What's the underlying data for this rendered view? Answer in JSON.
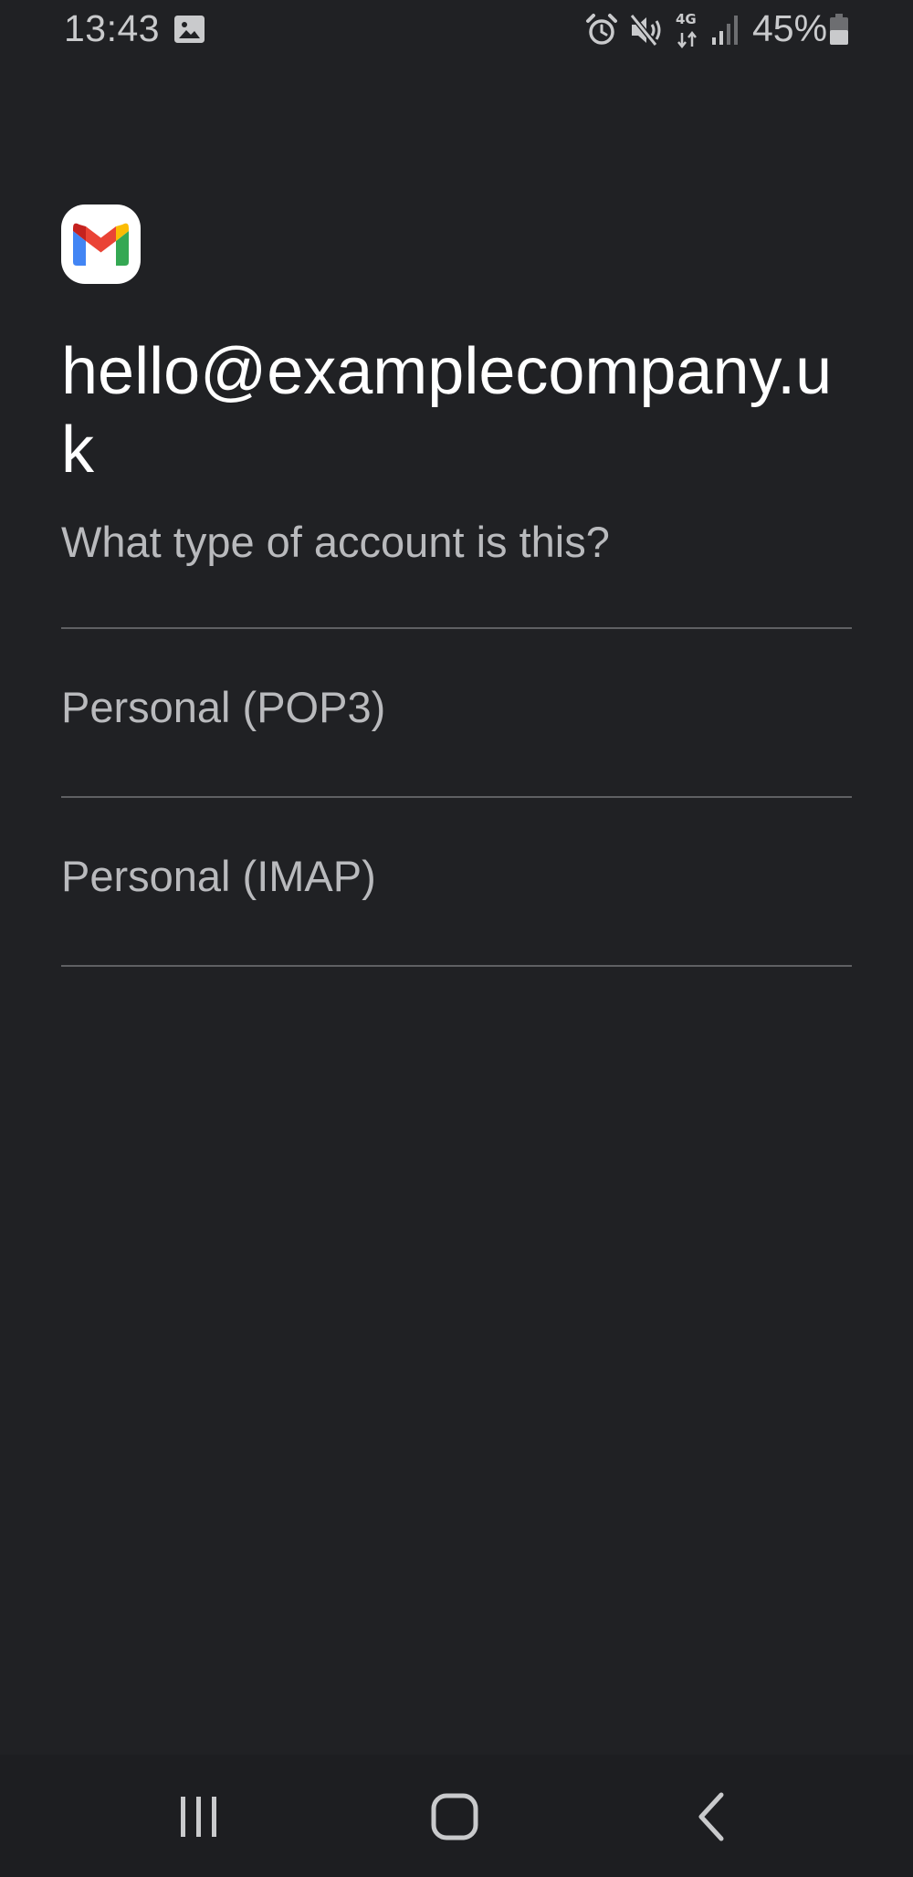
{
  "status_bar": {
    "time": "13:43",
    "network_type": "4G",
    "battery_percent": "45%",
    "icons": [
      "gallery-icon",
      "alarm-icon",
      "mute-icon",
      "network-4g-icon",
      "signal-icon",
      "battery-icon"
    ]
  },
  "app": {
    "logo": "gmail-logo-icon"
  },
  "account": {
    "email": "hello@examplecompany.uk",
    "question": "What type of account is this?"
  },
  "options": [
    {
      "label": "Personal (POP3)"
    },
    {
      "label": "Personal (IMAP)"
    }
  ],
  "nav_bar": {
    "buttons": [
      "recents-icon",
      "home-icon",
      "back-icon"
    ]
  },
  "colors": {
    "background": "#202124",
    "text_primary": "#ffffff",
    "text_secondary": "#b9babd",
    "divider": "#5f6063",
    "gmail_red": "#EA4335",
    "gmail_blue": "#4285F4",
    "gmail_green": "#34A853",
    "gmail_yellow": "#FBBC04"
  }
}
